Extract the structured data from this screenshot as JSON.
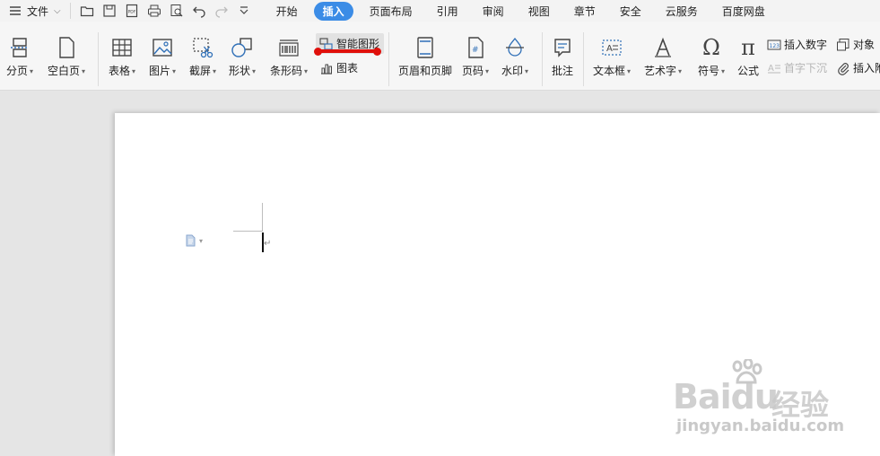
{
  "menubar": {
    "menu_label": "文件",
    "tabs": [
      "开始",
      "插入",
      "页面布局",
      "引用",
      "审阅",
      "视图",
      "章节",
      "安全",
      "云服务",
      "百度网盘"
    ],
    "active_tab": "插入"
  },
  "ribbon": {
    "page_break": "分页",
    "blank_page": "空白页",
    "table": "表格",
    "picture": "图片",
    "screenshot": "截屏",
    "shape": "形状",
    "barcode": "条形码",
    "smart_graphic": "智能图形",
    "chart": "图表",
    "header_footer": "页眉和页脚",
    "page_number": "页码",
    "watermark": "水印",
    "comment": "批注",
    "text_box": "文本框",
    "word_art": "艺术字",
    "symbol": "符号",
    "formula": "公式",
    "insert_number": "插入数字",
    "drop_cap": "首字下沉",
    "object": "对象",
    "insert_attachment": "插入附件"
  },
  "watermark": {
    "main_text": "Baidu",
    "cn_text": "经验",
    "url": "jingyan.baidu.com"
  },
  "colors": {
    "active_tab": "#3b8ce6",
    "highlight": "#e0100b",
    "icon_blue": "#2f6fb7"
  }
}
